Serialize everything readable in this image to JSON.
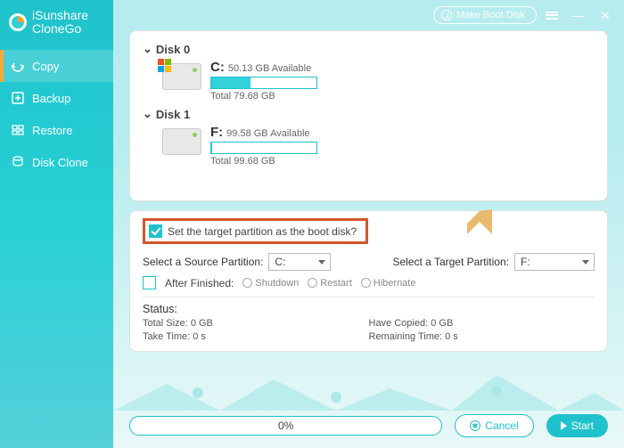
{
  "brand": {
    "line1": "iSunshare",
    "line2": "CloneGo"
  },
  "titlebar": {
    "make_boot": "Make Boot Disk"
  },
  "nav": {
    "copy": "Copy",
    "backup": "Backup",
    "restore": "Restore",
    "disk_clone": "Disk Clone"
  },
  "disks": [
    {
      "name": "Disk 0",
      "partitions": [
        {
          "letter": "C:",
          "available": "50.13 GB Available",
          "total": "Total 79.68 GB",
          "used_pct": 37,
          "is_system": true
        }
      ]
    },
    {
      "name": "Disk 1",
      "partitions": [
        {
          "letter": "F:",
          "available": "99.58 GB Available",
          "total": "Total 99.68 GB",
          "used_pct": 1,
          "is_system": false
        }
      ]
    }
  ],
  "options": {
    "boot_checkbox_label": "Set the target partition as the boot disk?",
    "boot_checkbox_checked": true,
    "source_label": "Select a Source Partition:",
    "source_value": "C:",
    "target_label": "Select a Target Partition:",
    "target_value": "F:",
    "after_finished_label": "After Finished:",
    "after_finished_checked": false,
    "radios": {
      "shutdown": "Shutdown",
      "restart": "Restart",
      "hibernate": "Hibernate"
    }
  },
  "status": {
    "title": "Status:",
    "total_size_label": "Total Size:",
    "total_size_value": "0 GB",
    "have_copied_label": "Have Copied:",
    "have_copied_value": "0 GB",
    "take_time_label": "Take Time:",
    "take_time_value": "0 s",
    "remaining_label": "Remaining Time:",
    "remaining_value": "0 s"
  },
  "footer": {
    "progress_text": "0%",
    "cancel": "Cancel",
    "start": "Start"
  }
}
